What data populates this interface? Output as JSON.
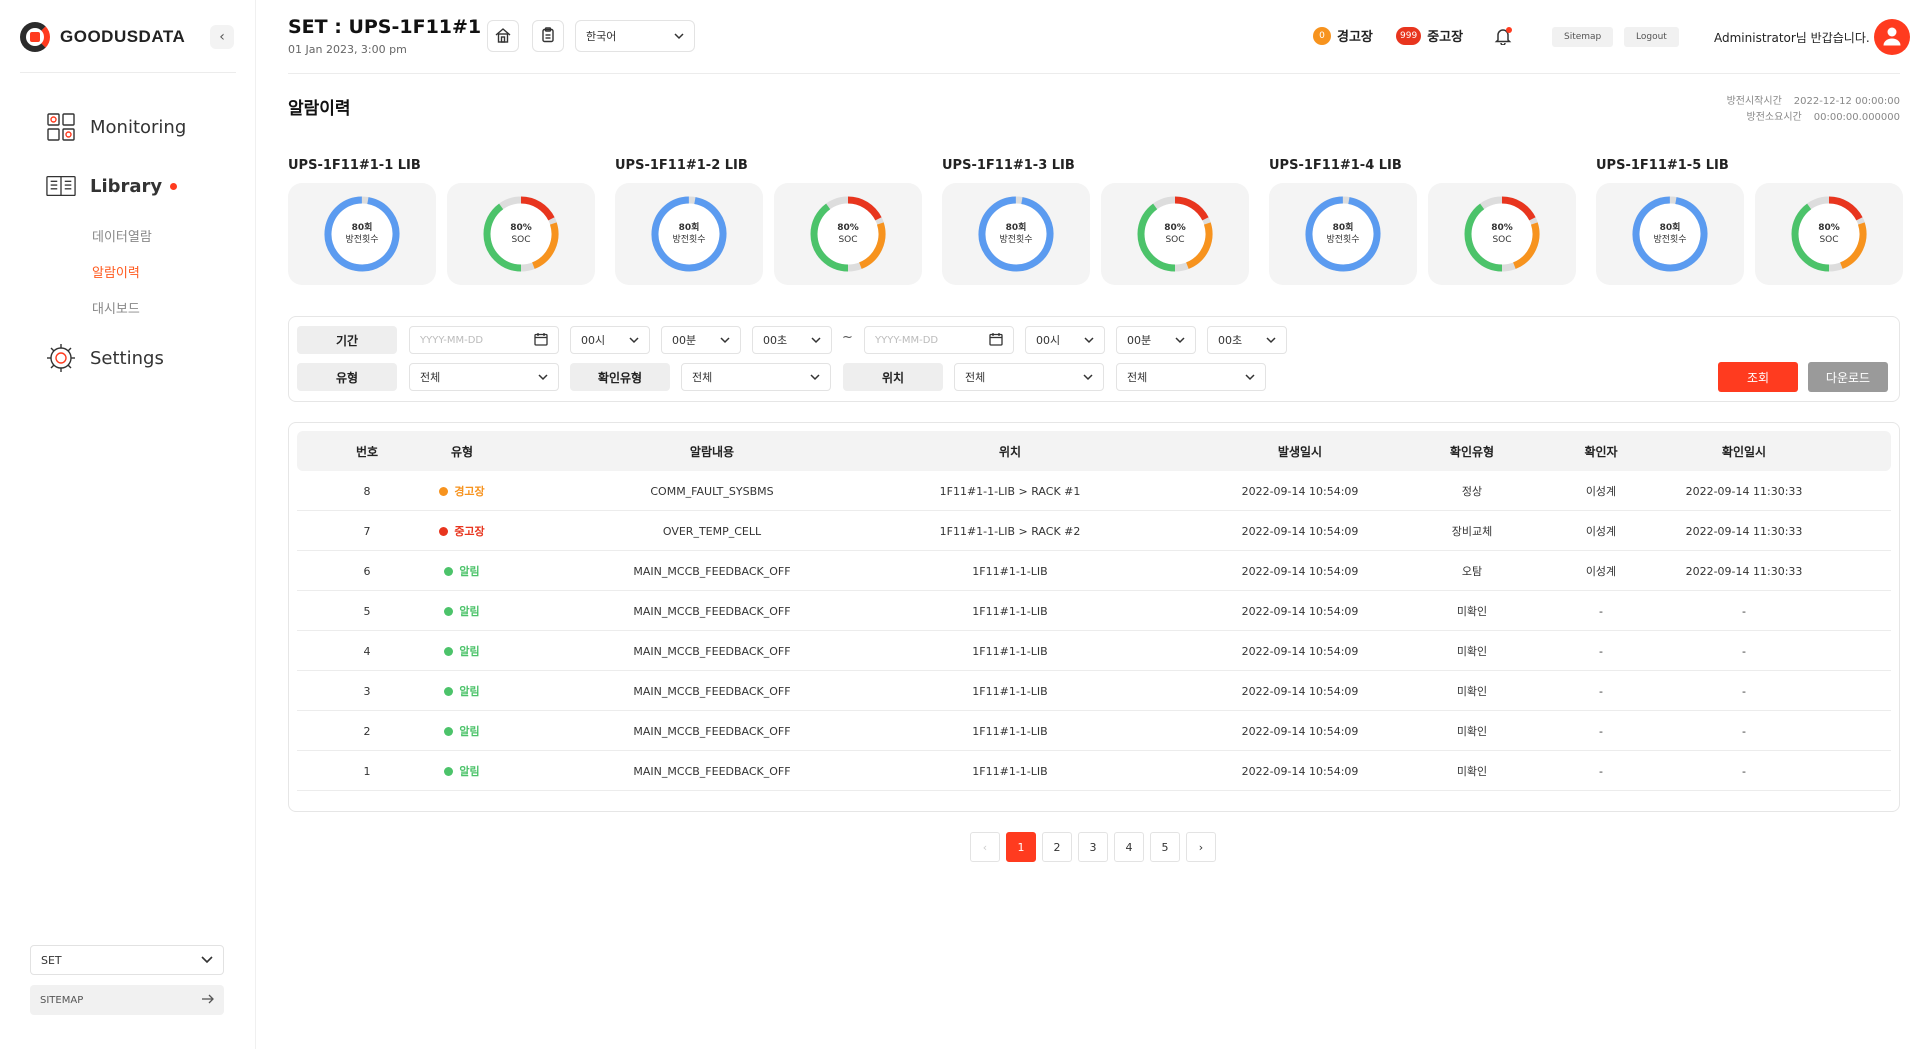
{
  "brand": {
    "logo_text": "GOODUSDATA",
    "accent": "#ff3b1f"
  },
  "sidebar": {
    "nav": [
      {
        "label": "Monitoring",
        "icon": "monitoring-icon"
      },
      {
        "label": "Library",
        "icon": "library-icon",
        "has_dot": true
      },
      {
        "label": "Settings",
        "icon": "settings-icon"
      }
    ],
    "sub_items": [
      "데이터열람",
      "알람이력",
      "대시보드"
    ],
    "active_sub": "알람이력",
    "bottom_select": "SET",
    "bottom_sitemap": "SITEMAP"
  },
  "header": {
    "title": "SET : UPS-1F11#1",
    "date": "01 Jan 2023, 3:00 pm",
    "language": "한국어",
    "warning_count": "0",
    "warning_label": "경고장",
    "fault_count": "999",
    "fault_label": "중고장",
    "sitemap_btn": "Sitemap",
    "logout_btn": "Logout",
    "greeting": "Administrator님 반갑습니다."
  },
  "page": {
    "section_title": "알람이력",
    "start_time_label": "방전시작시간",
    "start_time_value": "2022-12-12 00:00:00",
    "duration_label": "방전소요시간",
    "duration_value": "00:00:00.000000"
  },
  "units": [
    {
      "title": "UPS-1F11#1-1 LIB",
      "count_line1": "80회",
      "count_line2": "방전횟수",
      "soc_line1": "80%",
      "soc_line2": "SOC",
      "soc_percent": 80
    },
    {
      "title": "UPS-1F11#1-2 LIB",
      "count_line1": "80회",
      "count_line2": "방전횟수",
      "soc_line1": "80%",
      "soc_line2": "SOC",
      "soc_percent": 80
    },
    {
      "title": "UPS-1F11#1-3 LIB",
      "count_line1": "80회",
      "count_line2": "방전횟수",
      "soc_line1": "80%",
      "soc_line2": "SOC",
      "soc_percent": 80
    },
    {
      "title": "UPS-1F11#1-4 LIB",
      "count_line1": "80회",
      "count_line2": "방전횟수",
      "soc_line1": "80%",
      "soc_line2": "SOC",
      "soc_percent": 80
    },
    {
      "title": "UPS-1F11#1-5 LIB",
      "count_line1": "80회",
      "count_line2": "방전횟수",
      "soc_line1": "80%",
      "soc_line2": "SOC",
      "soc_percent": 80
    }
  ],
  "filter": {
    "period_label": "기간",
    "date_placeholder": "YYYY-MM-DD",
    "hour": "00시",
    "minute": "00분",
    "second": "00초",
    "tilde": "~",
    "type_label": "유형",
    "type_value": "전체",
    "confirm_type_label": "확인유형",
    "confirm_type_value": "전체",
    "location_label": "위치",
    "location_value1": "전체",
    "location_value2": "전체",
    "search_btn": "조회",
    "download_btn": "다운로드"
  },
  "table": {
    "columns": [
      "번호",
      "유형",
      "알람내용",
      "위치",
      "발생일시",
      "확인유형",
      "확인자",
      "확인일시"
    ],
    "rows": [
      {
        "no": "8",
        "type": "경고장",
        "type_color": "#f7931e",
        "content": "COMM_FAULT_SYSBMS",
        "location": "1F11#1-1-LIB > RACK #1",
        "occurred": "2022-09-14 10:54:09",
        "confirm_type": "정상",
        "confirmer": "이성계",
        "confirmed": "2022-09-14 11:30:33"
      },
      {
        "no": "7",
        "type": "중고장",
        "type_color": "#e8351e",
        "content": "OVER_TEMP_CELL",
        "location": "1F11#1-1-LIB > RACK #2",
        "occurred": "2022-09-14 10:54:09",
        "confirm_type": "장비교체",
        "confirmer": "이성계",
        "confirmed": "2022-09-14 11:30:33"
      },
      {
        "no": "6",
        "type": "알림",
        "type_color": "#4cc36a",
        "content": "MAIN_MCCB_FEEDBACK_OFF",
        "location": "1F11#1-1-LIB",
        "occurred": "2022-09-14 10:54:09",
        "confirm_type": "오탐",
        "confirmer": "이성계",
        "confirmed": "2022-09-14 11:30:33"
      },
      {
        "no": "5",
        "type": "알림",
        "type_color": "#4cc36a",
        "content": "MAIN_MCCB_FEEDBACK_OFF",
        "location": "1F11#1-1-LIB",
        "occurred": "2022-09-14 10:54:09",
        "confirm_type": "미확인",
        "confirmer": "-",
        "confirmed": "-"
      },
      {
        "no": "4",
        "type": "알림",
        "type_color": "#4cc36a",
        "content": "MAIN_MCCB_FEEDBACK_OFF",
        "location": "1F11#1-1-LIB",
        "occurred": "2022-09-14 10:54:09",
        "confirm_type": "미확인",
        "confirmer": "-",
        "confirmed": "-"
      },
      {
        "no": "3",
        "type": "알림",
        "type_color": "#4cc36a",
        "content": "MAIN_MCCB_FEEDBACK_OFF",
        "location": "1F11#1-1-LIB",
        "occurred": "2022-09-14 10:54:09",
        "confirm_type": "미확인",
        "confirmer": "-",
        "confirmed": "-"
      },
      {
        "no": "2",
        "type": "알림",
        "type_color": "#4cc36a",
        "content": "MAIN_MCCB_FEEDBACK_OFF",
        "location": "1F11#1-1-LIB",
        "occurred": "2022-09-14 10:54:09",
        "confirm_type": "미확인",
        "confirmer": "-",
        "confirmed": "-"
      },
      {
        "no": "1",
        "type": "알림",
        "type_color": "#4cc36a",
        "content": "MAIN_MCCB_FEEDBACK_OFF",
        "location": "1F11#1-1-LIB",
        "occurred": "2022-09-14 10:54:09",
        "confirm_type": "미확인",
        "confirmer": "-",
        "confirmed": "-"
      }
    ]
  },
  "pagination": {
    "pages": [
      "1",
      "2",
      "3",
      "4",
      "5"
    ],
    "current": "1",
    "prev": "‹",
    "next": "›"
  },
  "colors": {
    "blue_ring": "#5b9bf0",
    "green_ring": "#4cc36a",
    "orange_ring": "#f7931e",
    "red_ring": "#e8351e",
    "ring_track": "#dddddd"
  }
}
